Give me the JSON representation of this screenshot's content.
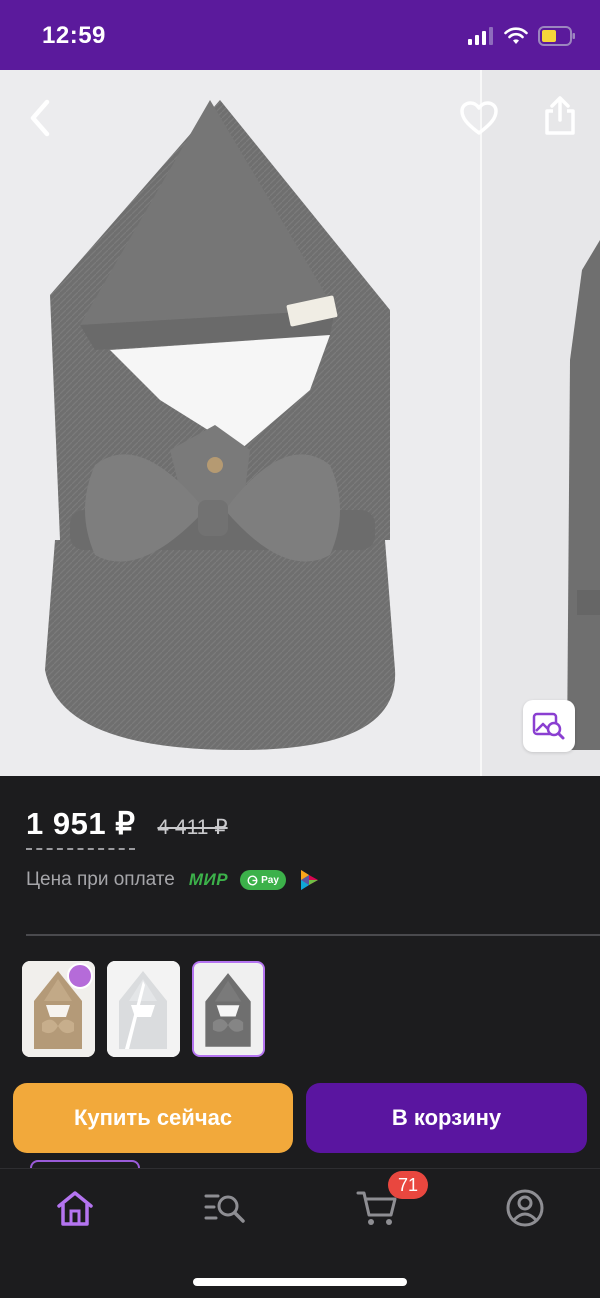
{
  "status_bar": {
    "time": "12:59",
    "icons": [
      "cellular-signal-icon",
      "wifi-icon",
      "battery-icon"
    ]
  },
  "hero": {
    "icons": [
      "back-chevron-icon",
      "heart-icon",
      "share-icon",
      "visual-search-icon"
    ]
  },
  "price": {
    "current": "1 951 ₽",
    "old": "4 411 ₽"
  },
  "payment": {
    "label": "Цена при оплате",
    "mir": "МИР",
    "gpay": "Pay"
  },
  "variants": [
    {
      "color": "beige",
      "badge": true,
      "selected": false
    },
    {
      "color": "white",
      "badge": false,
      "selected": false
    },
    {
      "color": "gray",
      "badge": false,
      "selected": true
    }
  ],
  "actions": {
    "buy_now": "Купить сейчас",
    "add_to_cart": "В корзину"
  },
  "tabbar": {
    "items": [
      "home-icon",
      "catalog-search-icon",
      "cart-icon",
      "profile-icon"
    ],
    "active": "home-icon",
    "cart_count": "71"
  },
  "colors": {
    "status_bar_bg": "#5b1a9c",
    "accent_purple": "#5a15a0",
    "buy_orange": "#f2a93b",
    "badge_red": "#e9473f",
    "pay_green": "#3cb14a",
    "active_tab": "#b474f0"
  }
}
